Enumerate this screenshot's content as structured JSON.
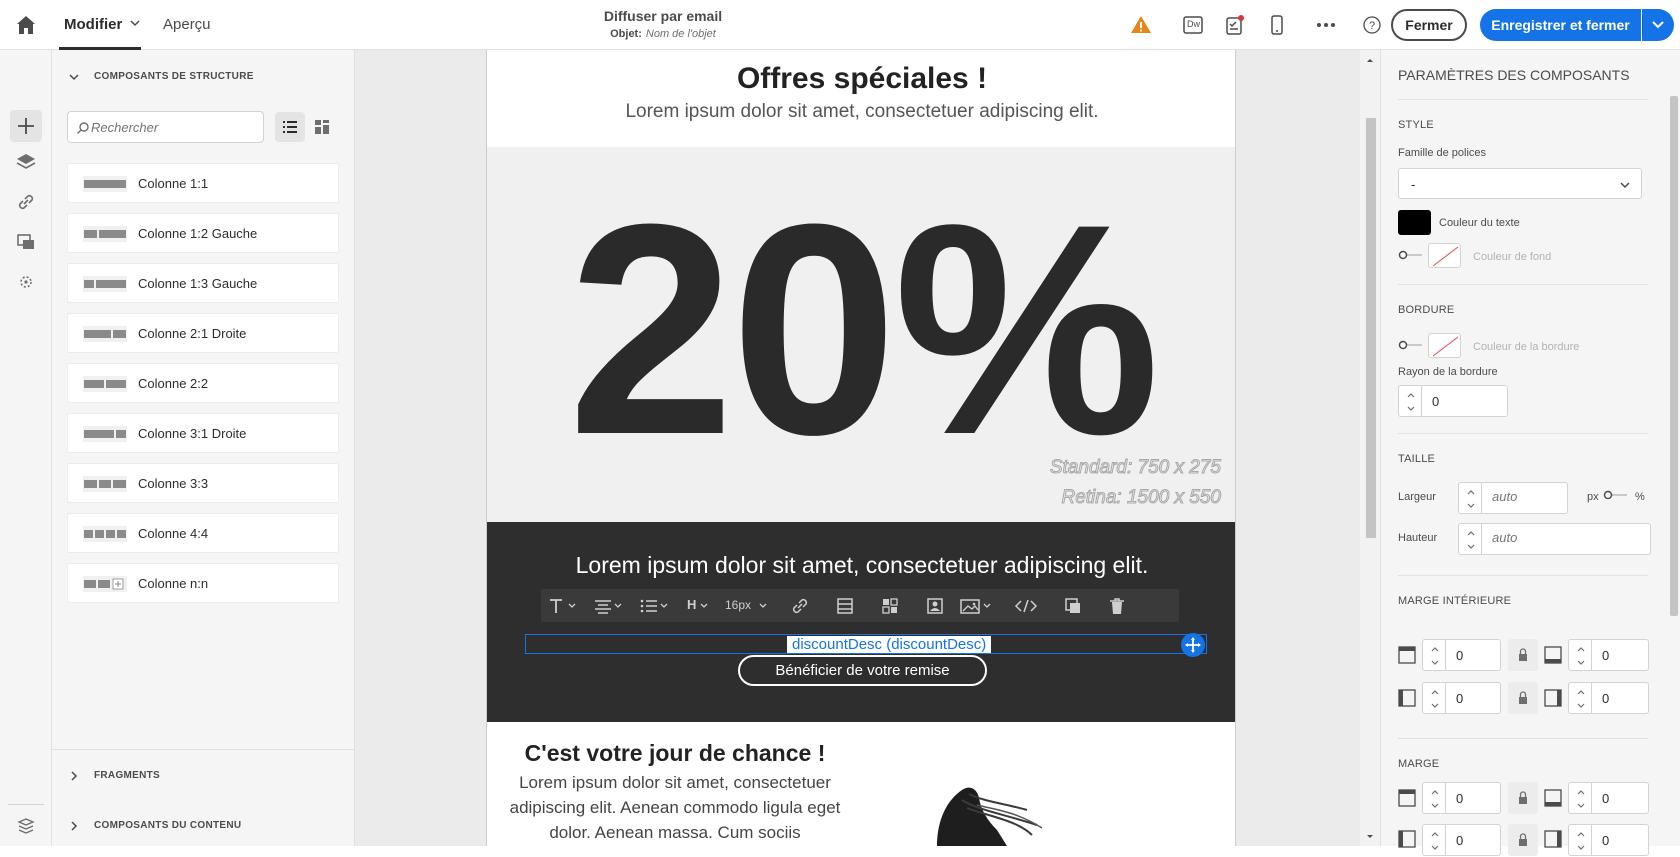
{
  "topbar": {
    "edit_tab": "Modifier",
    "preview_tab": "Aperçu",
    "title": "Diffuser par email",
    "subject_label": "Objet:",
    "subject_placeholder": "Nom de l'objet",
    "dw_label": "Dw",
    "close_button": "Fermer",
    "save_button": "Enregistrer et fermer"
  },
  "left_panel": {
    "structure_header": "COMPOSANTS DE STRUCTURE",
    "search_placeholder": "Rechercher",
    "components": [
      {
        "label": "Colonne 1:1"
      },
      {
        "label": "Colonne 1:2 Gauche"
      },
      {
        "label": "Colonne 1:3 Gauche"
      },
      {
        "label": "Colonne 2:1 Droite"
      },
      {
        "label": "Colonne 2:2"
      },
      {
        "label": "Colonne 3:1 Droite"
      },
      {
        "label": "Colonne 3:3"
      },
      {
        "label": "Colonne 4:4"
      },
      {
        "label": "Colonne n:n"
      }
    ],
    "fragments_header": "FRAGMENTS",
    "content_header": "COMPOSANTS DU CONTENU"
  },
  "email": {
    "hero_title": "Offres spéciales !",
    "hero_subtitle": "Lorem ipsum dolor sit amet, consectetuer adipiscing elit.",
    "big_text": "20%",
    "standard_dim": "Standard: 750 x 275",
    "retina_dim": "Retina: 1500 x 550",
    "dark_text": "Lorem ipsum dolor sit amet, consectetuer adipiscing elit.",
    "toolbar_font_size": "16px",
    "toolbar_heading": "H",
    "selected_text": "discountDesc (discountDesc)",
    "cta": "Bénéficier de votre remise",
    "lucky_title": "C'est votre jour de chance !",
    "lucky_body": "Lorem ipsum dolor sit amet, consectetuer adipiscing elit. Aenean commodo ligula eget dolor. Aenean massa. Cum sociis"
  },
  "right_panel": {
    "title": "PARAMÈTRES DES COMPOSANTS",
    "style_header": "STYLE",
    "font_family_label": "Famille de polices",
    "font_family_value": "-",
    "text_color_label": "Couleur du texte",
    "text_color": "#000000",
    "bg_color_label": "Couleur de fond",
    "border_header": "BORDURE",
    "border_color_label": "Couleur de la bordure",
    "border_radius_label": "Rayon de la bordure",
    "border_radius_value": "0",
    "size_header": "TAILLE",
    "width_label": "Largeur",
    "width_placeholder": "auto",
    "unit_px": "px",
    "unit_pct": "%",
    "height_label": "Hauteur",
    "height_placeholder": "auto",
    "padding_header": "MARGE INTÉRIEURE",
    "padding_values": [
      "0",
      "0",
      "0",
      "0"
    ],
    "margin_header": "MARGE",
    "margin_values": [
      "0",
      "0",
      "0",
      "0"
    ]
  },
  "colors": {
    "accent": "#1473e6",
    "warning": "#e68619",
    "dark_block": "#2e2e2e"
  }
}
